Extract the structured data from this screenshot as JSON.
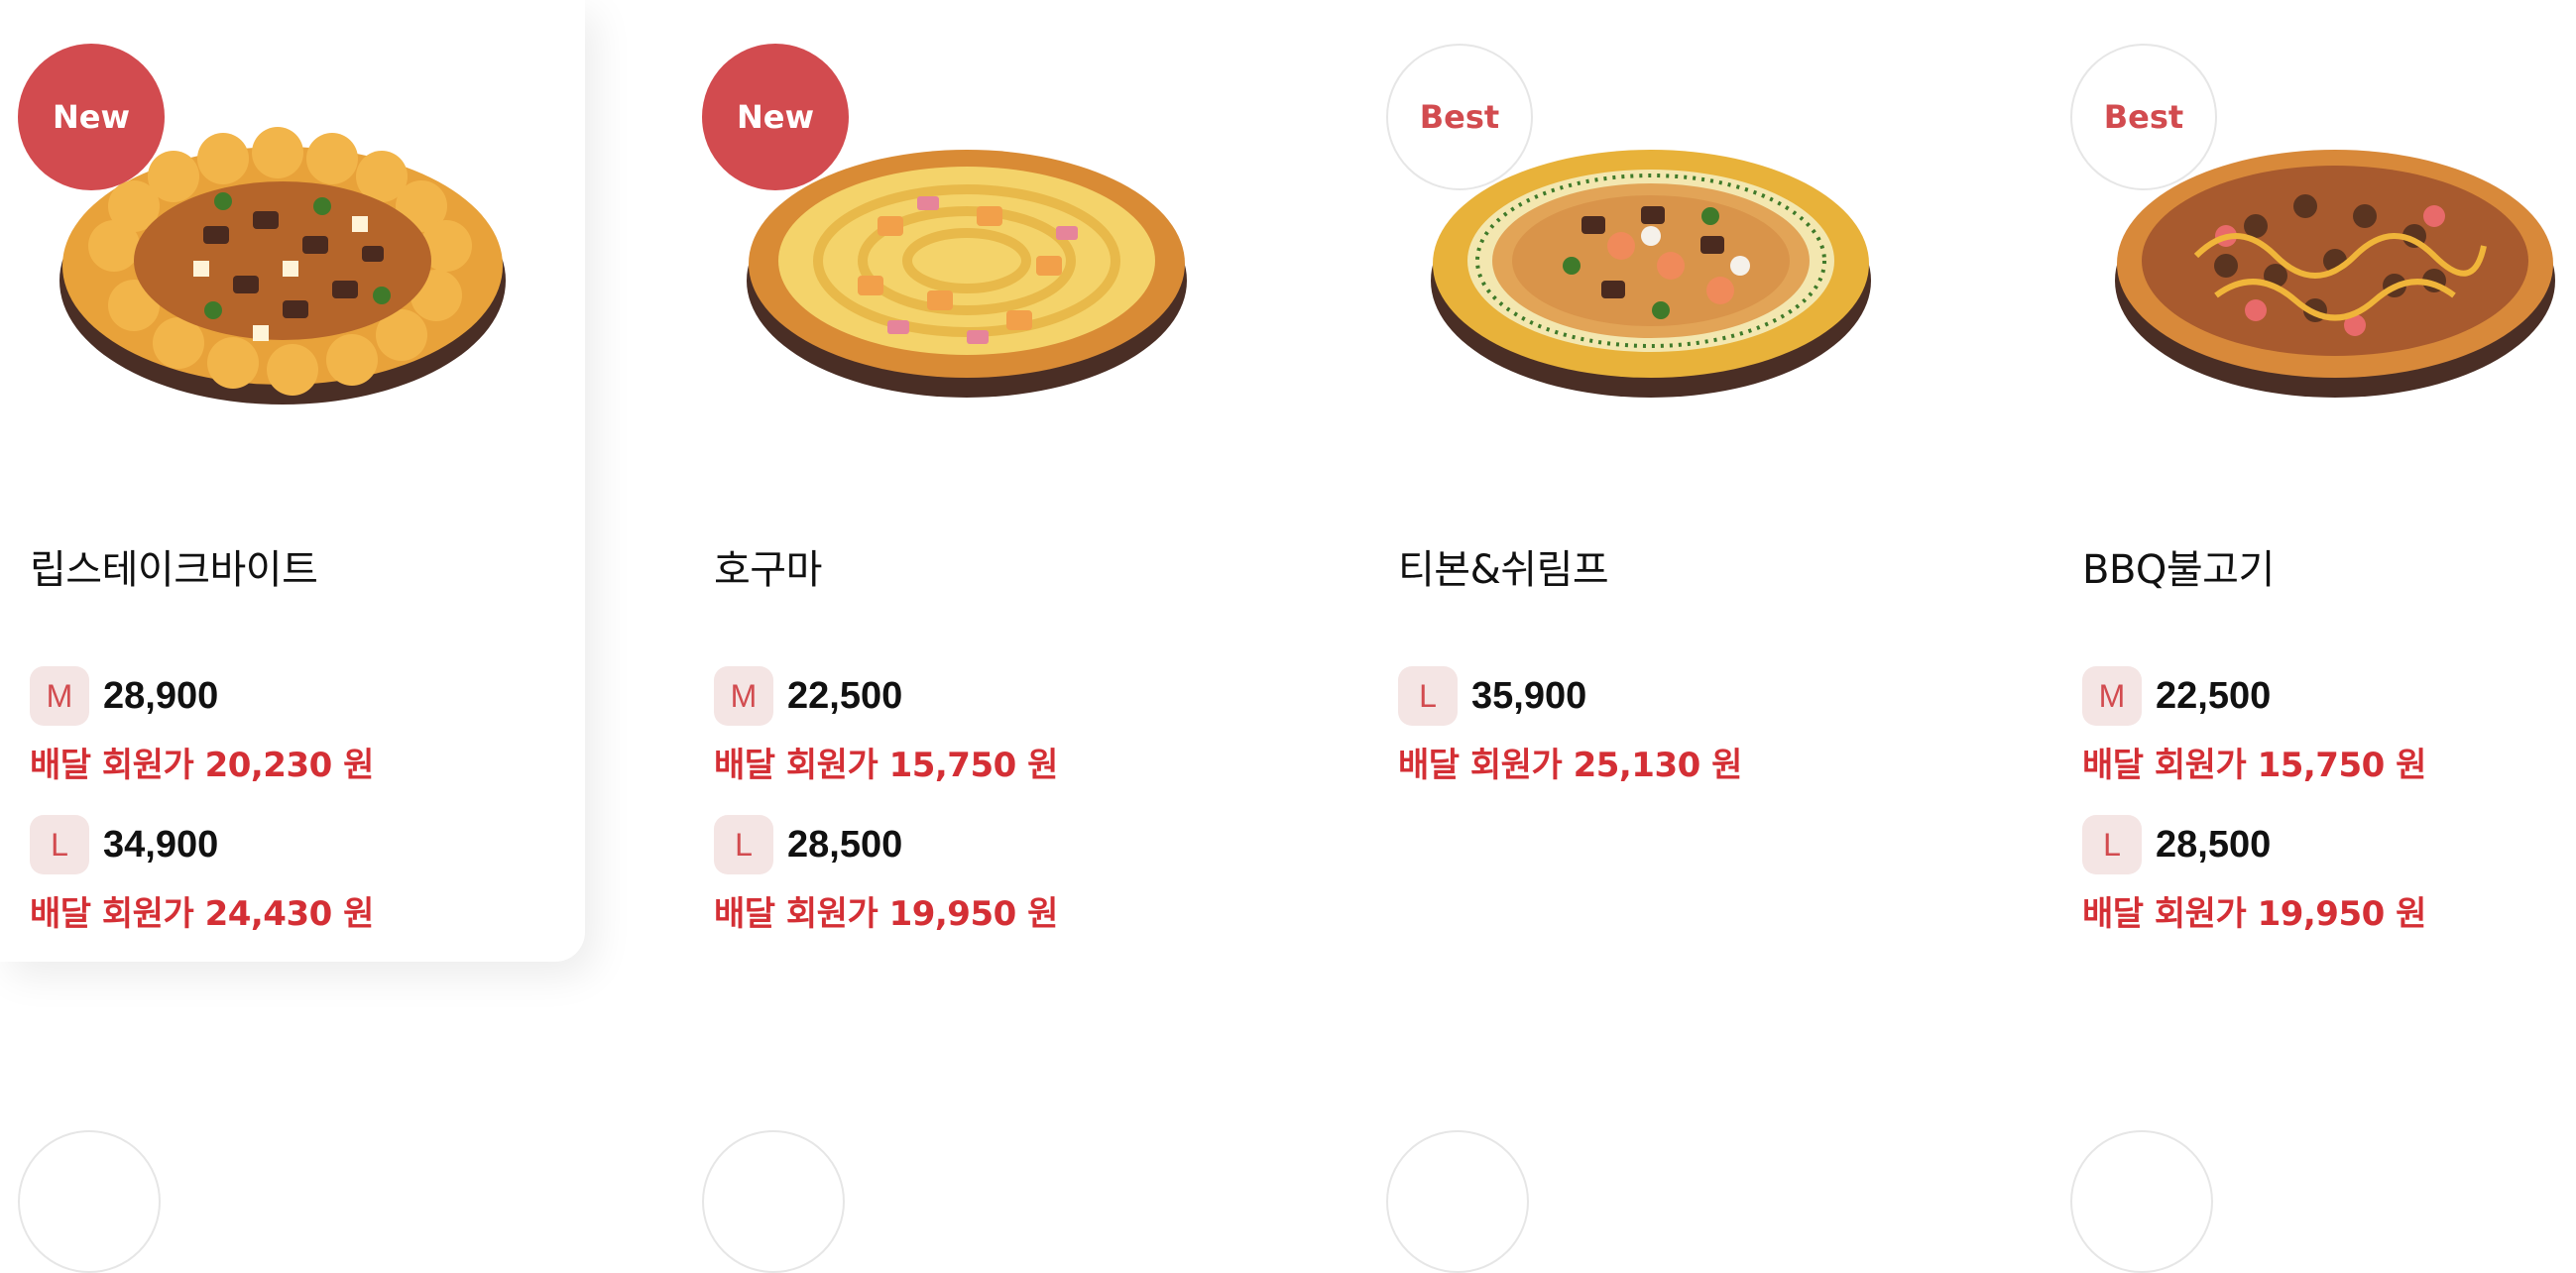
{
  "menu": [
    {
      "badge": "New",
      "badge_style": "new",
      "name": "립스테이크바이트",
      "highlight": true,
      "prices": [
        {
          "size": "M",
          "price": "28,900",
          "member_price": "배달 회원가 20,230 원"
        },
        {
          "size": "L",
          "price": "34,900",
          "member_price": "배달 회원가 24,430 원"
        }
      ]
    },
    {
      "badge": "New",
      "badge_style": "new",
      "name": "호구마",
      "prices": [
        {
          "size": "M",
          "price": "22,500",
          "member_price": "배달 회원가 15,750 원"
        },
        {
          "size": "L",
          "price": "28,500",
          "member_price": "배달 회원가 19,950 원"
        }
      ]
    },
    {
      "badge": "Best",
      "badge_style": "best",
      "name": "티본&쉬림프",
      "prices": [
        {
          "size": "L",
          "price": "35,900",
          "member_price": "배달 회원가 25,130 원"
        }
      ]
    },
    {
      "badge": "Best",
      "badge_style": "best",
      "name": "BBQ불고기",
      "prices": [
        {
          "size": "M",
          "price": "22,500",
          "member_price": "배달 회원가 15,750 원"
        },
        {
          "size": "L",
          "price": "28,500",
          "member_price": "배달 회원가 19,950 원"
        }
      ]
    }
  ],
  "colors": {
    "accent": "#d24b4f",
    "member_price": "#d42f35",
    "size_badge_bg": "#f4e5e4"
  }
}
